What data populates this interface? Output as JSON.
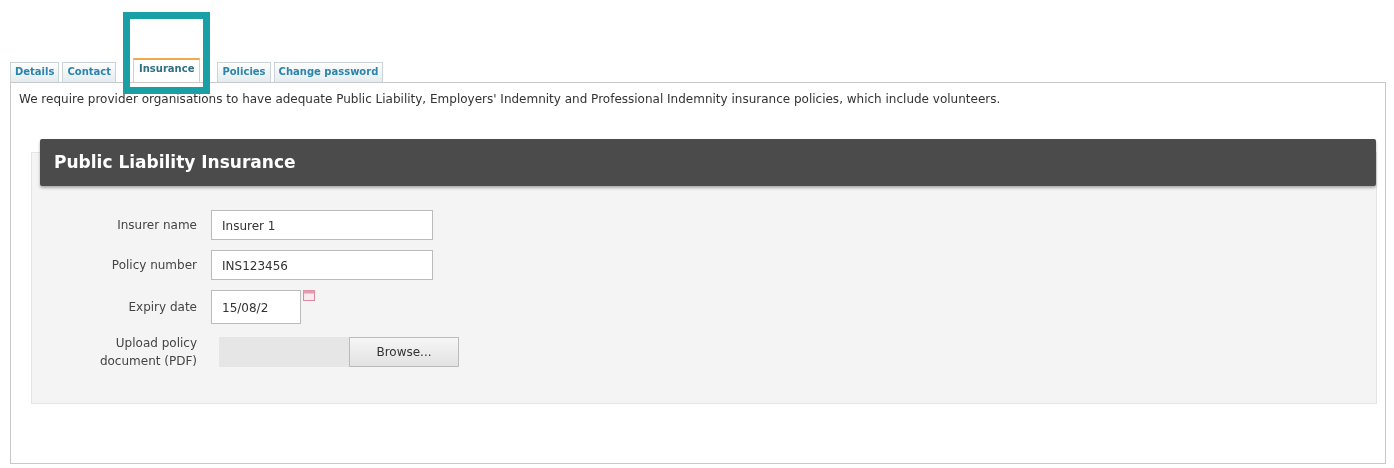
{
  "tabs": [
    {
      "label": "Details",
      "selected": false
    },
    {
      "label": "Contact",
      "selected": false
    },
    {
      "label": "Insurance",
      "selected": true
    },
    {
      "label": "Policies",
      "selected": false
    },
    {
      "label": "Change password",
      "selected": false
    }
  ],
  "intro": "We require provider organisations to have adequate Public Liability, Employers' Indemnity and Professional Indemnity insurance policies, which include volunteers.",
  "section": {
    "title": "Public Liability Insurance",
    "fields": [
      {
        "kind": "text",
        "label": "Insurer name",
        "value": "Insurer 1"
      },
      {
        "kind": "text",
        "label": "Policy number",
        "value": "INS123456"
      },
      {
        "kind": "date",
        "label": "Expiry date",
        "value": "15/08/2"
      },
      {
        "kind": "file",
        "label": "Upload policy document (PDF)",
        "button": "Browse..."
      }
    ]
  }
}
